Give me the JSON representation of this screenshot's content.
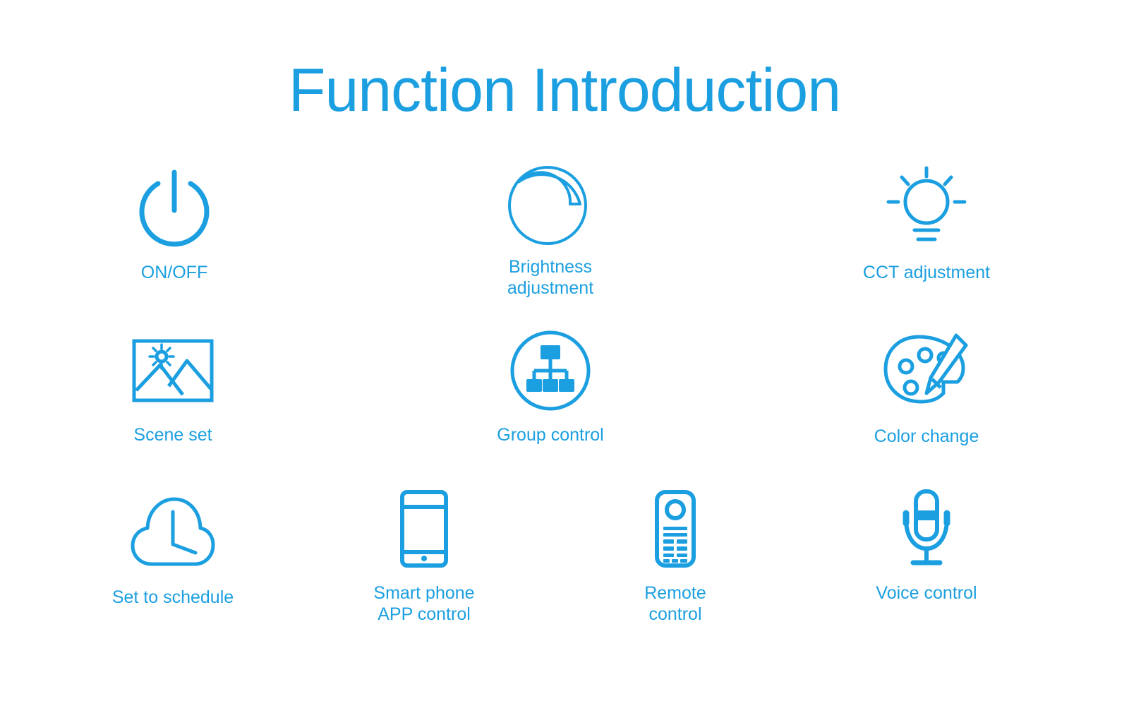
{
  "page": {
    "background_color": "#ffffff",
    "accent_color": "#1b9fe0",
    "title": "Function Introduction"
  },
  "features": {
    "rows": [
      [
        {
          "id": "on-off",
          "label": "ON/OFF",
          "icon": "power-icon"
        },
        {
          "id": "brightness-adjustment",
          "label": "Brightness adjustment",
          "icon": "brightness-gauge-icon"
        },
        {
          "id": "cct-adjustment",
          "label": "CCT adjustment",
          "icon": "light-bulb-icon"
        }
      ],
      [
        {
          "id": "scene-set",
          "label": "Scene set",
          "icon": "picture-landscape-icon"
        },
        {
          "id": "group-control",
          "label": "Group control",
          "icon": "hierarchy-circle-icon"
        },
        {
          "id": "color-change",
          "label": "Color change",
          "icon": "palette-brush-icon"
        }
      ],
      [
        {
          "id": "set-to-schedule",
          "label": "Set to schedule",
          "icon": "cloud-clock-icon"
        },
        {
          "id": "smart-phone-app",
          "label": "Smart phone\nAPP control",
          "icon": "smartphone-icon"
        },
        {
          "id": "remote-control",
          "label": "Remote\ncontrol",
          "icon": "remote-control-icon"
        },
        {
          "id": "voice-control",
          "label": "Voice control",
          "icon": "microphone-icon"
        }
      ]
    ]
  }
}
